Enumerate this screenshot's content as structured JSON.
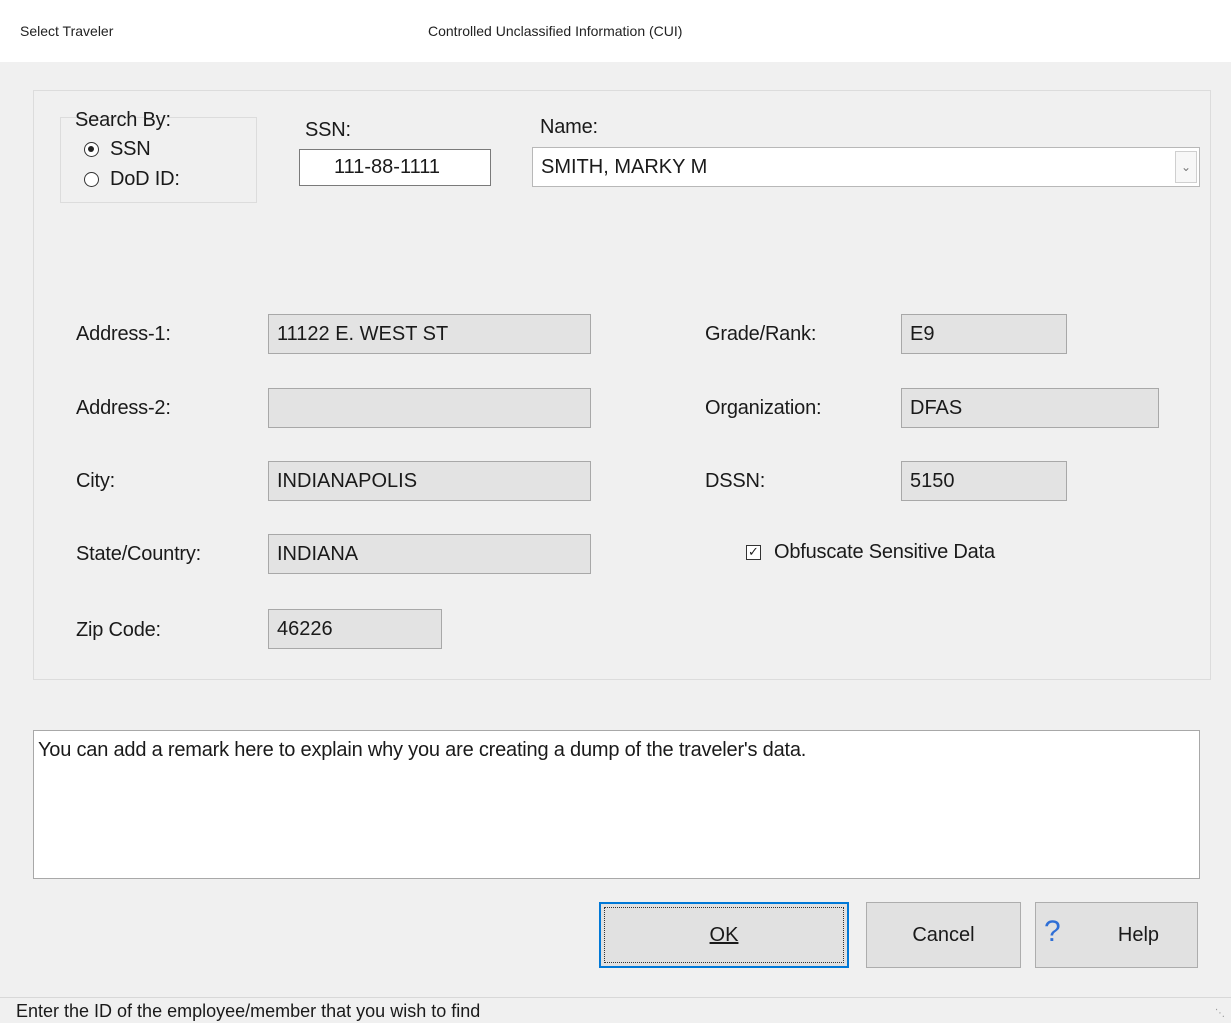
{
  "window": {
    "title": "Select Traveler",
    "banner": "Controlled Unclassified Information (CUI)"
  },
  "search": {
    "group_label": "Search By:",
    "options": [
      "SSN",
      "DoD ID:"
    ],
    "selected": "SSN"
  },
  "ssn": {
    "label": "SSN:",
    "value": "111-88-1111"
  },
  "name": {
    "label": "Name:",
    "value": "SMITH, MARKY M"
  },
  "fields": {
    "address1": {
      "label": "Address-1:",
      "value": "11122 E. WEST ST"
    },
    "address2": {
      "label": "Address-2:",
      "value": ""
    },
    "city": {
      "label": "City:",
      "value": "INDIANAPOLIS"
    },
    "state": {
      "label": "State/Country:",
      "value": "INDIANA"
    },
    "zip": {
      "label": "Zip Code:",
      "value": "46226"
    },
    "grade": {
      "label": "Grade/Rank:",
      "value": "E9"
    },
    "org": {
      "label": "Organization:",
      "value": "DFAS"
    },
    "dssn": {
      "label": "DSSN:",
      "value": "5150"
    }
  },
  "obfuscate": {
    "label": "Obfuscate Sensitive Data",
    "checked": true
  },
  "remarks": "You can add a remark here to explain why you are creating a dump of the traveler's data.",
  "buttons": {
    "ok": "OK",
    "cancel": "Cancel",
    "help": "Help"
  },
  "status": "Enter the ID of the employee/member that you wish to find"
}
